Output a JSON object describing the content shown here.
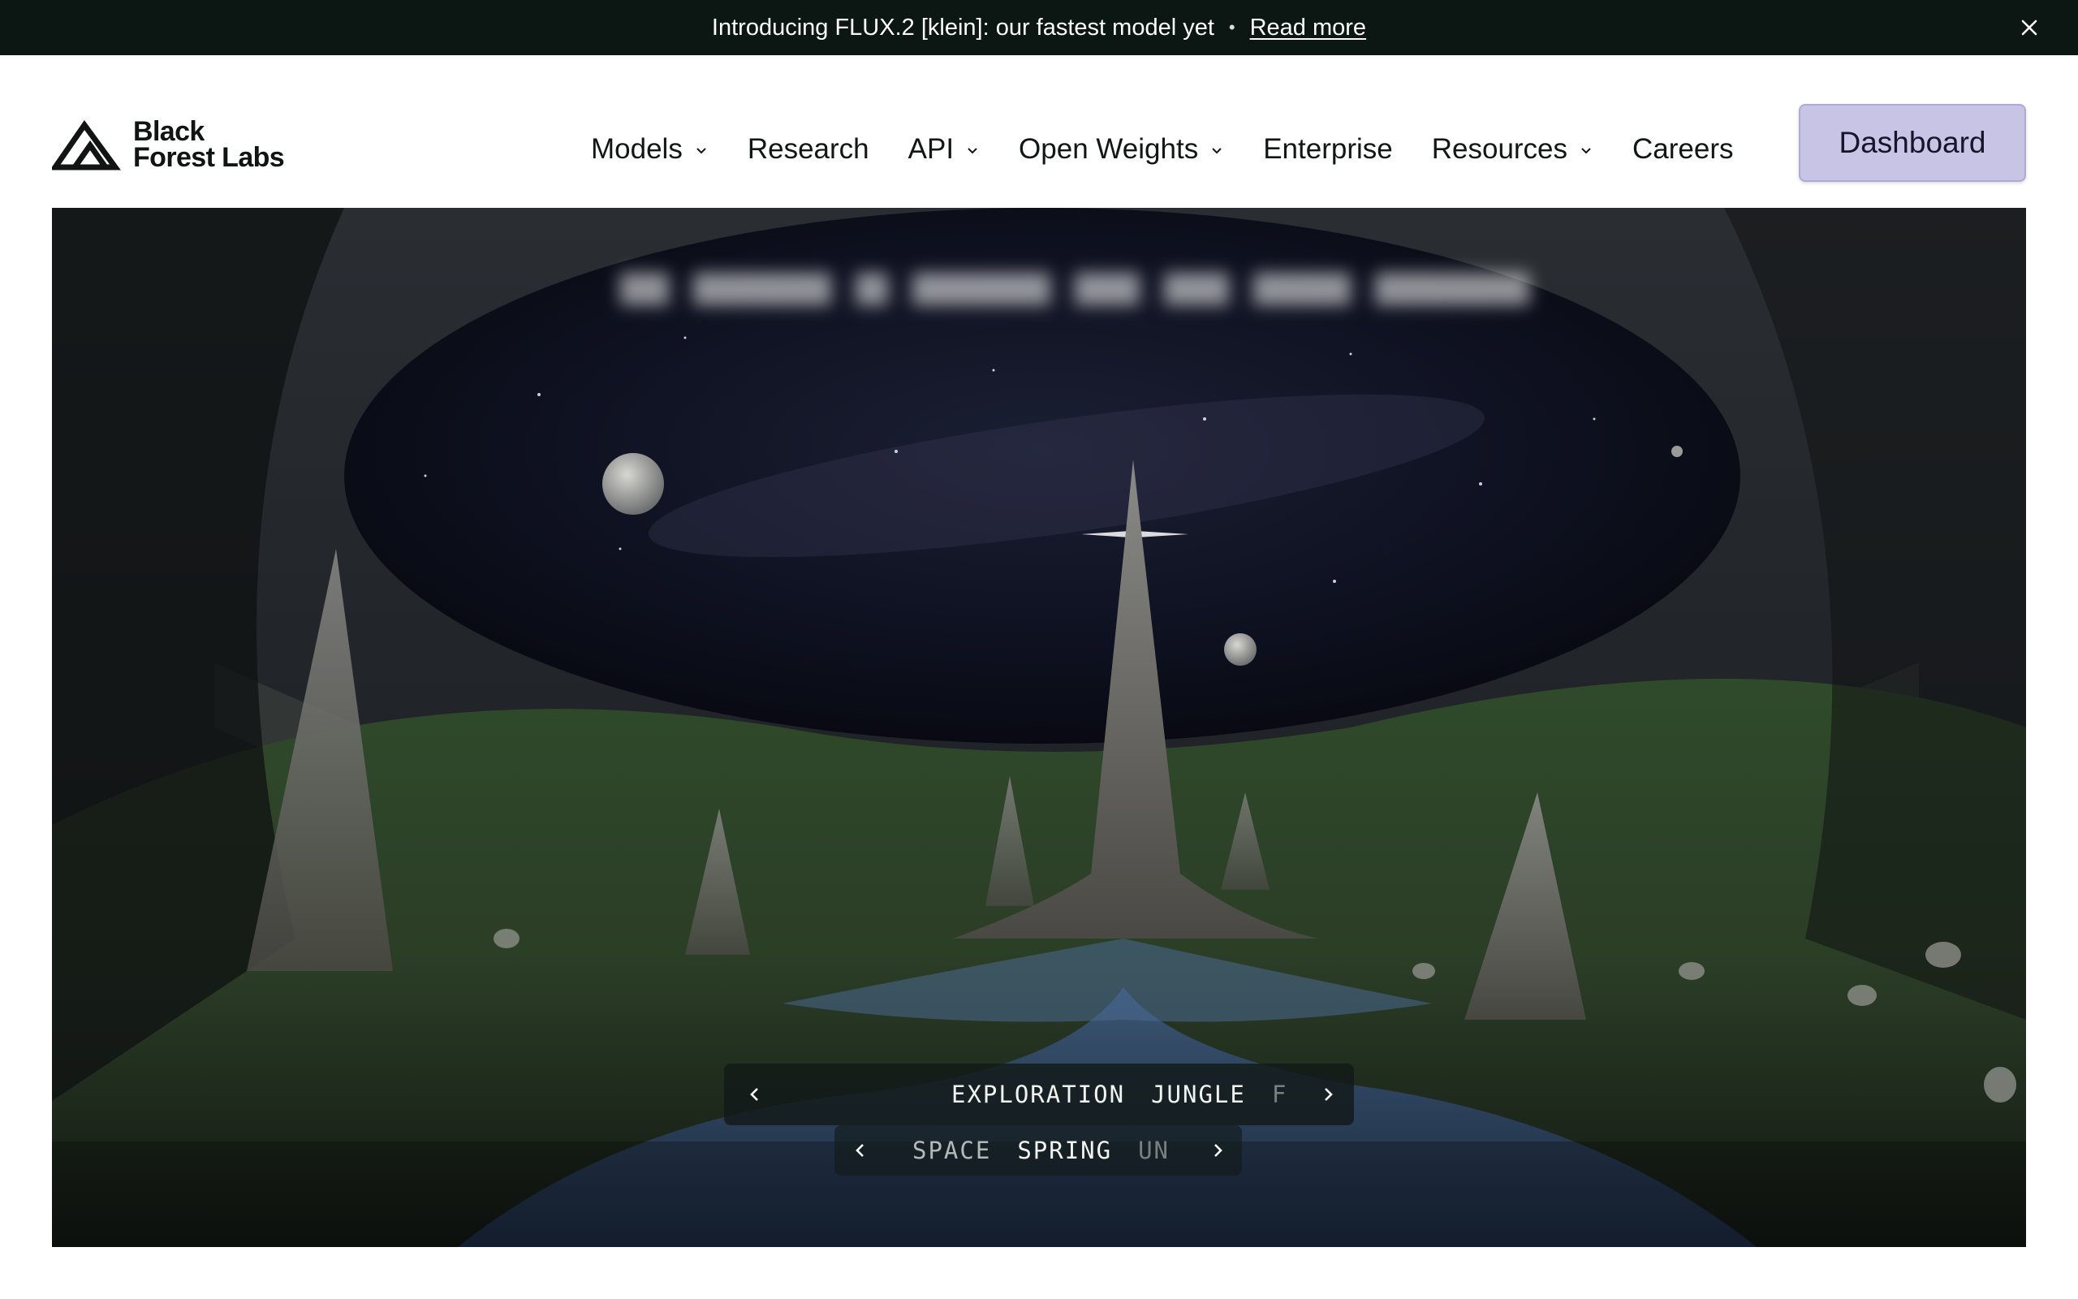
{
  "announcement": {
    "text": "Introducing FLUX.2 [klein]: our fastest model yet",
    "separator": "•",
    "link_label": "Read more"
  },
  "brand": {
    "name_line1": "Black",
    "name_line2": "Forest Labs"
  },
  "nav": {
    "models": "Models",
    "research": "Research",
    "api": "API",
    "open_weights": "Open Weights",
    "enterprise": "Enterprise",
    "resources": "Resources",
    "careers": "Careers"
  },
  "dashboard_label": "Dashboard",
  "carousel": {
    "row1": [
      "EXPLORATION",
      "JUNGLE",
      "F"
    ],
    "row2": [
      "SPACE",
      "SPRING",
      "UN"
    ]
  },
  "icons": {
    "close": "close-icon",
    "chevron": "chevron-down-icon",
    "prev": "chevron-left-icon",
    "next": "chevron-right-icon"
  },
  "colors": {
    "announcement_bg": "#0c1714",
    "dashboard_bg": "#c7c4e6",
    "text": "#121614"
  }
}
